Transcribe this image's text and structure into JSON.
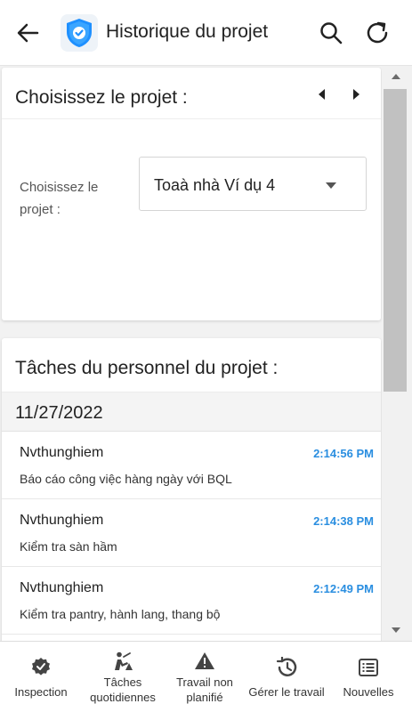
{
  "header": {
    "title": "Historique du projet",
    "icons": [
      "back-arrow-icon",
      "shield-check-icon",
      "search-icon",
      "refresh-icon"
    ]
  },
  "project_card": {
    "title": "Choisissez le projet :",
    "field_label": "Choisissez le projet :",
    "selected_project": "Toaà nhà Ví dụ 4"
  },
  "tasks_card": {
    "title": "Tâches du personnel du projet :",
    "date": "11/27/2022",
    "tasks": [
      {
        "user": "Nvthunghiem",
        "time": "2:14:56 PM",
        "description": "Báo cáo công việc hàng ngày với BQL"
      },
      {
        "user": "Nvthunghiem",
        "time": "2:14:38 PM",
        "description": "Kiểm tra sàn hầm"
      },
      {
        "user": "Nvthunghiem",
        "time": "2:12:49 PM",
        "description": "Kiểm tra pantry, hành lang, thang bộ"
      }
    ]
  },
  "bottom_nav": {
    "items": [
      {
        "label": "Inspection",
        "icon": "badge-check-icon"
      },
      {
        "label": "Tâches quotidiennes",
        "icon": "worker-icon"
      },
      {
        "label": "Travail non planifié",
        "icon": "warning-icon"
      },
      {
        "label": "Gérer le travail",
        "icon": "history-icon"
      },
      {
        "label": "Nouvelles",
        "icon": "news-list-icon"
      }
    ]
  },
  "colors": {
    "accent": "#2a8ee0",
    "shield": "#1e90ff"
  }
}
